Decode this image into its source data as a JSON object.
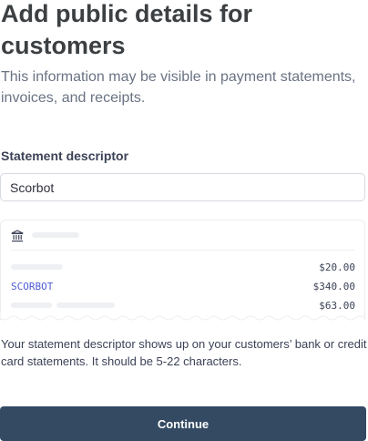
{
  "header": {
    "title": "Add public details for customers",
    "subtitle": "This information may be visible in payment statements, invoices, and receipts."
  },
  "form": {
    "descriptor_label": "Statement descriptor",
    "descriptor_value": "Scorbot"
  },
  "preview": {
    "bank_icon": "bank-icon",
    "rows": [
      {
        "label": "",
        "amount": "$20.00"
      },
      {
        "label": "SCORBOT",
        "amount": "$340.00"
      },
      {
        "label": "",
        "amount": "$63.00"
      }
    ],
    "descriptor_color": "#4f5bd5"
  },
  "helper_text": "Your statement descriptor shows up on your customers’ bank or credit card statements. It should be 5-22 characters.",
  "actions": {
    "continue_label": "Continue",
    "button_color": "#344a63"
  }
}
